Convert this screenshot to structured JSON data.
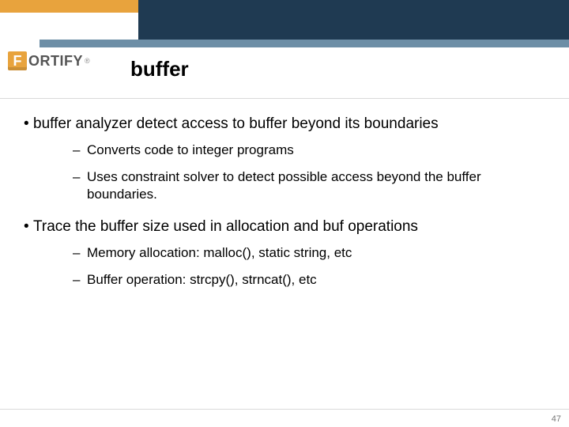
{
  "brand": {
    "initial": "F",
    "rest": "ORTIFY",
    "registered": "®"
  },
  "title": "buffer",
  "bullets": [
    {
      "text": "buffer analyzer detect access to buffer beyond its boundaries",
      "sub": [
        "Converts code to integer programs",
        "Uses constraint solver to detect possible access beyond the buffer boundaries."
      ]
    },
    {
      "text": "Trace the buffer size used in allocation and buf operations",
      "sub": [
        "Memory allocation: malloc(), static string, etc",
        "Buffer operation: strcpy(), strncat(), etc"
      ]
    }
  ],
  "page_number": "47",
  "glyphs": {
    "bullet": "•",
    "dash": "–"
  }
}
